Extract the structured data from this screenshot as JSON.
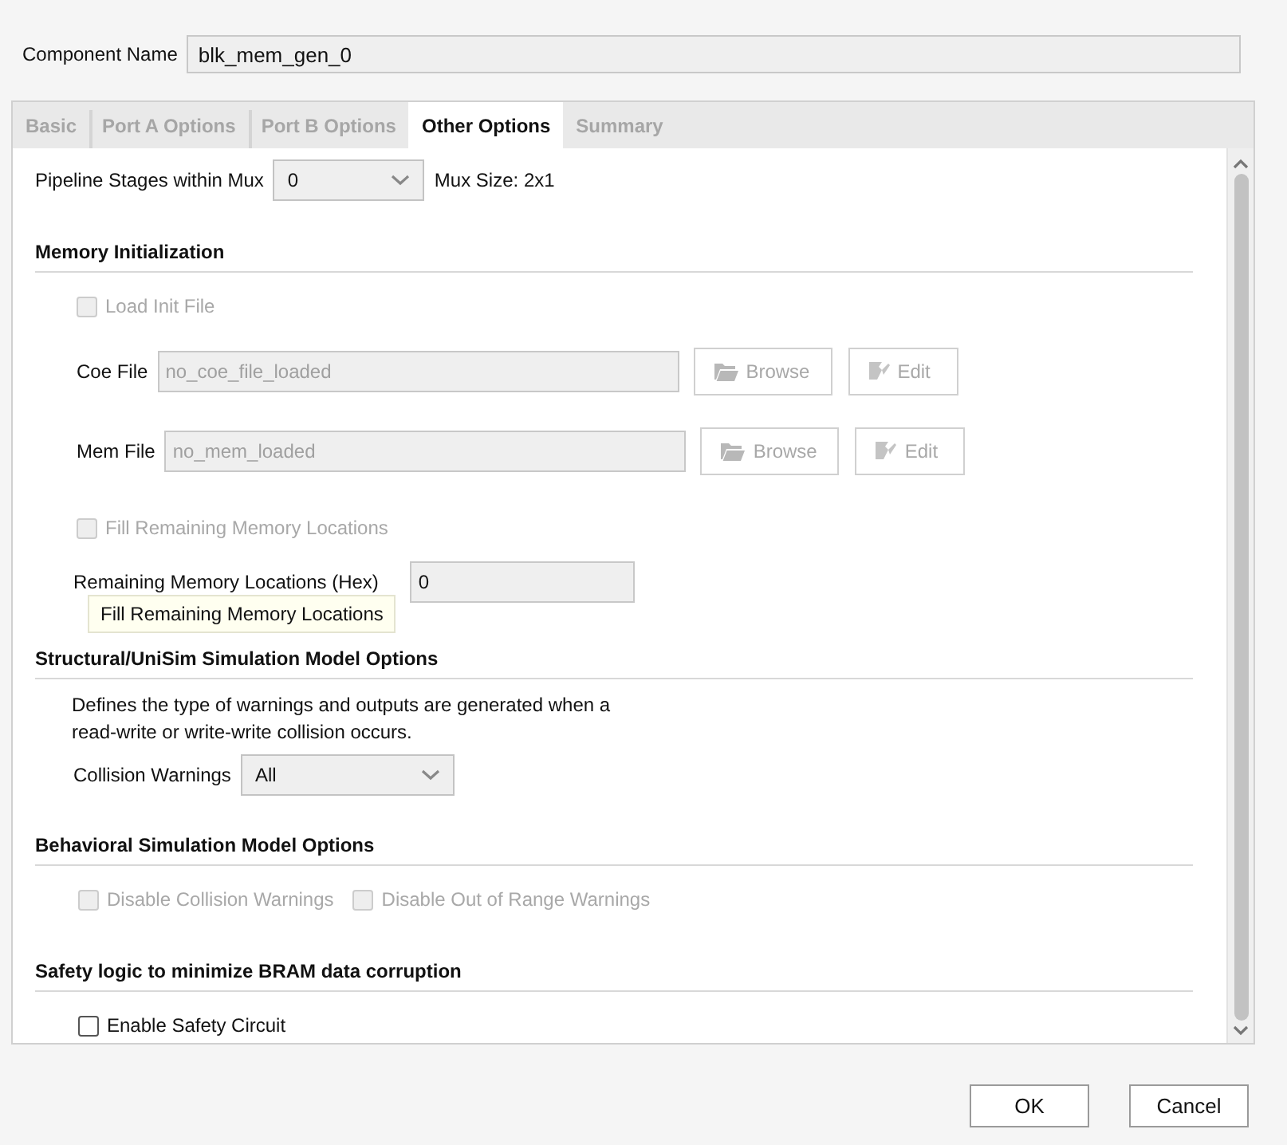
{
  "component_name": {
    "label": "Component Name",
    "value": "blk_mem_gen_0"
  },
  "tabs": [
    {
      "label": "Basic",
      "selected": false
    },
    {
      "label": "Port A Options",
      "selected": false
    },
    {
      "label": "Port B Options",
      "selected": false
    },
    {
      "label": "Other Options",
      "selected": true
    },
    {
      "label": "Summary",
      "selected": false
    }
  ],
  "pipeline": {
    "label": "Pipeline Stages within Mux",
    "value": "0",
    "note": "Mux Size: 2x1"
  },
  "memory_initialization": {
    "title": "Memory Initialization",
    "load_init_file": {
      "label": "Load Init File",
      "checked": false,
      "disabled": true
    },
    "files": [
      {
        "label": "Coe File",
        "value": "no_coe_file_loaded",
        "browse": "Browse",
        "edit": "Edit",
        "disabled": true
      },
      {
        "label": "Mem File",
        "value": "no_mem_loaded",
        "browse": "Browse",
        "edit": "Edit",
        "disabled": true
      }
    ],
    "fill_remaining": {
      "label": "Fill Remaining Memory Locations",
      "checked": false,
      "disabled": true
    },
    "remaining": {
      "label": "Remaining Memory Locations (Hex)",
      "value": "0"
    },
    "tooltip": "Fill Remaining Memory Locations"
  },
  "structural": {
    "title": "Structural/UniSim Simulation Model Options",
    "description": "Defines the type of warnings and outputs are generated when a read-write or write-write collision occurs.",
    "collision_warnings": {
      "label": "Collision Warnings",
      "value": "All"
    }
  },
  "behavioral": {
    "title": "Behavioral Simulation Model Options",
    "checkboxes": [
      {
        "label": "Disable Collision Warnings",
        "checked": false,
        "disabled": true
      },
      {
        "label": "Disable Out of Range Warnings",
        "checked": false,
        "disabled": true
      }
    ]
  },
  "safety": {
    "title": "Safety logic to minimize BRAM data corruption",
    "checkbox": {
      "label": "Enable Safety Circuit",
      "checked": false,
      "disabled": false
    }
  },
  "buttons": [
    "OK",
    "Cancel"
  ]
}
